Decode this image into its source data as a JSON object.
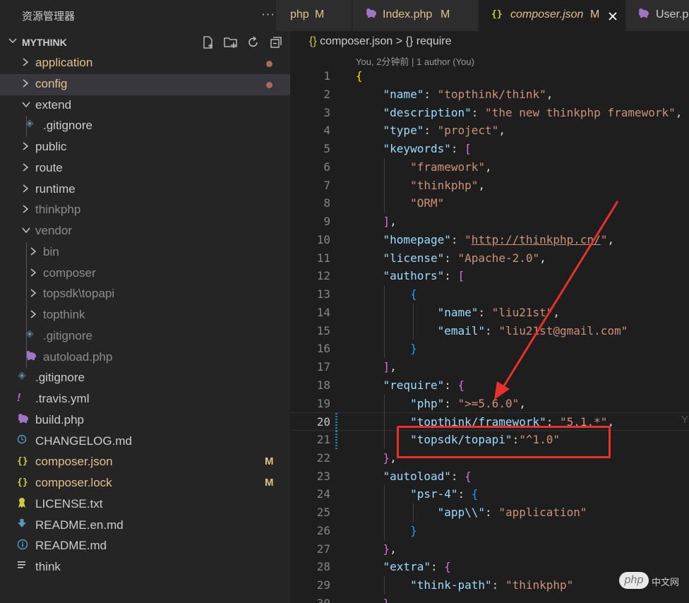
{
  "sidebar": {
    "title": "资源管理器",
    "more_label": "···",
    "section": {
      "name": "MYTHINK",
      "expanded": true
    },
    "tree": [
      {
        "label": "application",
        "icon": "chevron-right-icon",
        "color": "#e2c08d",
        "dot": true
      },
      {
        "label": "config",
        "icon": "chevron-right-icon",
        "color": "#e2c08d",
        "dot": true
      },
      {
        "label": "extend",
        "icon": "chevron-down-icon",
        "color": "#cccccc"
      },
      {
        "label": ".gitignore",
        "icon": "git-icon",
        "color": "#cccccc"
      },
      {
        "label": "public",
        "icon": "chevron-right-icon",
        "color": "#cccccc"
      },
      {
        "label": "route",
        "icon": "chevron-right-icon",
        "color": "#cccccc"
      },
      {
        "label": "runtime",
        "icon": "chevron-right-icon",
        "color": "#cccccc"
      },
      {
        "label": "thinkphp",
        "icon": "chevron-right-icon",
        "color": "#8c8c8c"
      },
      {
        "label": "vendor",
        "icon": "chevron-down-icon",
        "color": "#8c8c8c"
      },
      {
        "label": "bin",
        "icon": "chevron-right-icon",
        "color": "#8c8c8c"
      },
      {
        "label": "composer",
        "icon": "chevron-right-icon",
        "color": "#8c8c8c"
      },
      {
        "label": "topsdk\\topapi",
        "icon": "chevron-right-icon",
        "color": "#8c8c8c"
      },
      {
        "label": "topthink",
        "icon": "chevron-right-icon",
        "color": "#8c8c8c"
      },
      {
        "label": ".gitignore",
        "icon": "git-icon",
        "color": "#8c8c8c"
      },
      {
        "label": "autoload.php",
        "icon": "php-icon",
        "color": "#8c8c8c"
      },
      {
        "label": ".gitignore",
        "icon": "git-icon",
        "color": "#cccccc"
      },
      {
        "label": ".travis.yml",
        "icon": "exclamation-icon",
        "color": "#cccccc"
      },
      {
        "label": "build.php",
        "icon": "php-icon",
        "color": "#cccccc"
      },
      {
        "label": "CHANGELOG.md",
        "icon": "clock-icon",
        "color": "#cccccc"
      },
      {
        "label": "composer.json",
        "icon": "braces-icon",
        "color": "#e2c08d",
        "mark": "M"
      },
      {
        "label": "composer.lock",
        "icon": "braces-icon",
        "color": "#e2c08d",
        "mark": "M"
      },
      {
        "label": "LICENSE.txt",
        "icon": "ribbon-icon",
        "color": "#cccccc"
      },
      {
        "label": "README.en.md",
        "icon": "download-icon",
        "color": "#cccccc"
      },
      {
        "label": "README.md",
        "icon": "info-icon",
        "color": "#cccccc"
      },
      {
        "label": "think",
        "icon": "lines-icon",
        "color": "#cccccc"
      }
    ]
  },
  "tabs": [
    {
      "name": "php",
      "modified": "M",
      "icon": "php-icon"
    },
    {
      "name": "Index.php",
      "modified": "M",
      "icon": "php-icon"
    },
    {
      "name": "composer.json",
      "modified": "M",
      "icon": "braces-icon",
      "active": true
    },
    {
      "name": "User.p",
      "modified": "",
      "icon": "php-icon"
    }
  ],
  "breadcrumb": {
    "file": "composer.json",
    "separator": ">",
    "symbol": "require"
  },
  "blame": "You, 2分钟前 | 1 author (You)",
  "editor": {
    "current_line": 20,
    "lines": [
      {
        "n": 1,
        "text": "{"
      },
      {
        "n": 2,
        "text": "    \"name\": \"topthink/think\","
      },
      {
        "n": 3,
        "text": "    \"description\": \"the new thinkphp framework\","
      },
      {
        "n": 4,
        "text": "    \"type\": \"project\","
      },
      {
        "n": 5,
        "text": "    \"keywords\": ["
      },
      {
        "n": 6,
        "text": "        \"framework\","
      },
      {
        "n": 7,
        "text": "        \"thinkphp\","
      },
      {
        "n": 8,
        "text": "        \"ORM\""
      },
      {
        "n": 9,
        "text": "    ],"
      },
      {
        "n": 10,
        "text": "    \"homepage\": \"http://thinkphp.cn/\","
      },
      {
        "n": 11,
        "text": "    \"license\": \"Apache-2.0\","
      },
      {
        "n": 12,
        "text": "    \"authors\": ["
      },
      {
        "n": 13,
        "text": "        {"
      },
      {
        "n": 14,
        "text": "            \"name\": \"liu21st\","
      },
      {
        "n": 15,
        "text": "            \"email\": \"liu21st@gmail.com\""
      },
      {
        "n": 16,
        "text": "        }"
      },
      {
        "n": 17,
        "text": "    ],"
      },
      {
        "n": 18,
        "text": "    \"require\": {"
      },
      {
        "n": 19,
        "text": "        \"php\": \">=5.6.0\","
      },
      {
        "n": 20,
        "text": "        \"topthink/framework\": \"5.1.*\","
      },
      {
        "n": 21,
        "text": "        \"topsdk/topapi\":\"^1.0\""
      },
      {
        "n": 22,
        "text": "    },"
      },
      {
        "n": 23,
        "text": "    \"autoload\": {"
      },
      {
        "n": 24,
        "text": "        \"psr-4\": {"
      },
      {
        "n": 25,
        "text": "            \"app\\\\\": \"application\""
      },
      {
        "n": 26,
        "text": "        }"
      },
      {
        "n": 27,
        "text": "    },"
      },
      {
        "n": 28,
        "text": "    \"extra\": {"
      },
      {
        "n": 29,
        "text": "        \"think-path\": \"thinkphp\""
      },
      {
        "n": 30,
        "text": "    }"
      }
    ]
  },
  "inline_hint": "Y",
  "watermark": {
    "logo": "php",
    "text": "中文网"
  },
  "colors": {
    "accent_modified": "#e2c08d",
    "annotation_red": "#e8312a"
  }
}
